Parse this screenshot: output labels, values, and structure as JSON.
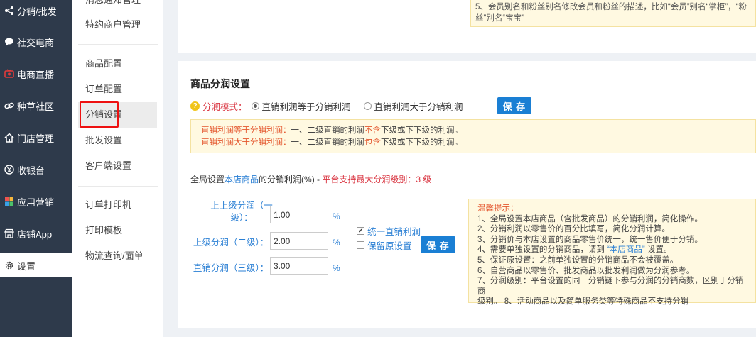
{
  "nav": {
    "items": [
      {
        "label": "分销/批发",
        "icon": "share-icon"
      },
      {
        "label": "社交电商",
        "icon": "chat-icon"
      },
      {
        "label": "电商直播",
        "icon": "tv-icon"
      },
      {
        "label": "种草社区",
        "icon": "link-icon"
      },
      {
        "label": "门店管理",
        "icon": "home-icon"
      },
      {
        "label": "收银台",
        "icon": "yen-icon"
      },
      {
        "label": "应用营销",
        "icon": "apps-icon"
      },
      {
        "label": "店铺App",
        "icon": "shop-icon"
      },
      {
        "label": "设置",
        "icon": "gear-icon"
      }
    ],
    "active": "设置",
    "colors": {
      "bg": "#2e3a4b",
      "live_icon": "#e23b3b"
    }
  },
  "submenu": {
    "items": [
      "消息通知管理",
      "特约商户管理",
      "商品配置",
      "订单配置",
      "分销设置",
      "批发设置",
      "客户端设置",
      "订单打印机",
      "打印模板",
      "物流查询/面单"
    ],
    "active": "分销设置"
  },
  "top_tip": {
    "line1": "5、会员别名和粉丝别名修改会员和粉丝的描述，比如“会员”别名“掌柜”，“粉",
    "line2": "丝”别名“宝宝”"
  },
  "section": {
    "title": "商品分润设置",
    "mode_label": "分润模式：",
    "option1": "直销利润等于分销利润",
    "option2": "直销利润大于分销利润",
    "selected": "直销利润等于分销利润",
    "save_label": "保 存"
  },
  "mode_tip": {
    "l1_key": "直销利润等于分销利润：",
    "l1_a": "一、二级直销的利润",
    "l1_em": "不含",
    "l1_b": "下级或下下级的利润。",
    "l2_key": "直销利润大于分销利润：",
    "l2_a": "一、二级直销的利润",
    "l2_em": "包含",
    "l2_b": "下级或下下级的利润。"
  },
  "global": {
    "prefix": "全局设置",
    "link": "本店商品",
    "mid": "的分销利润(%) - ",
    "hint": "平台支持最大分润级别：3 级"
  },
  "fields": [
    {
      "label_a": "上上级分润（一",
      "label_b": "级）：",
      "value": "1.00",
      "unit": "%"
    },
    {
      "label_a": "上级分润（二级）：",
      "label_b": "",
      "value": "2.00",
      "unit": "%"
    },
    {
      "label_a": "直销分润（三级）：",
      "label_b": "",
      "value": "3.00",
      "unit": "%"
    }
  ],
  "options": {
    "unify_label": "统一直销利润",
    "unify_checked": true,
    "keep_label": "保留原设置",
    "keep_checked": false,
    "save_label": "保 存"
  },
  "tips": {
    "title": "温馨提示：",
    "t1": "1、全局设置本店商品（含批发商品）的分销利润，简化操作。",
    "t2": "2、分销利润以零售价的百分比填写，简化分润计算。",
    "t3": "3、分销价与本店设置的商品零售价统一，统一售价便于分销。",
    "t4a": "4、需要单独设置的分销商品，请到 ",
    "t4link": "“本店商品”",
    "t4b": " 设置。",
    "t5": "5、保证原设置：之前单独设置的分销商品不会被覆盖。",
    "t6": "6、自营商品以零售价、批发商品以批发利润做为分润参考。",
    "t7": "7、分润级别：平台设置的同一分销链下参与分润的分销商数，区别于分销商",
    "t8": "级别。 8、活动商品以及简单服务类等特殊商品不支持分销"
  }
}
